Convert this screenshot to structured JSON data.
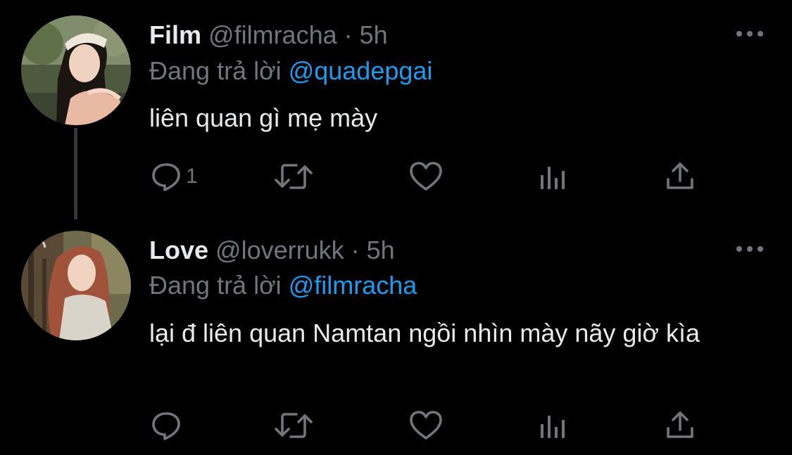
{
  "tweets": [
    {
      "display_name": "Film",
      "handle": "@filmracha",
      "separator": " · ",
      "time": "5h",
      "reply_prefix": "Đang trả lời ",
      "reply_to": "@quadepgai",
      "text": "liên quan gì mẹ mày",
      "reply_count": "1",
      "avatar_icon": "profile-photo-icon"
    },
    {
      "display_name": "Love",
      "handle": "@loverrukk",
      "separator": " · ",
      "time": "5h",
      "reply_prefix": "Đang trả lời ",
      "reply_to": "@filmracha",
      "text": "lại đ liên quan Namtan ngồi nhìn mày nãy giờ kìa",
      "reply_count": "",
      "avatar_icon": "profile-photo-icon"
    }
  ],
  "icons": {
    "reply": "speech-bubble-icon",
    "retweet": "retweet-arrows-icon",
    "like": "heart-icon",
    "analytics": "bar-chart-icon",
    "share": "share-upload-icon",
    "more": "more-dots-icon"
  },
  "colors": {
    "background": "#000000",
    "primary_text": "#e7e9ea",
    "secondary_text": "#71767b",
    "link": "#1d9bf0",
    "thread_line": "#333639"
  }
}
